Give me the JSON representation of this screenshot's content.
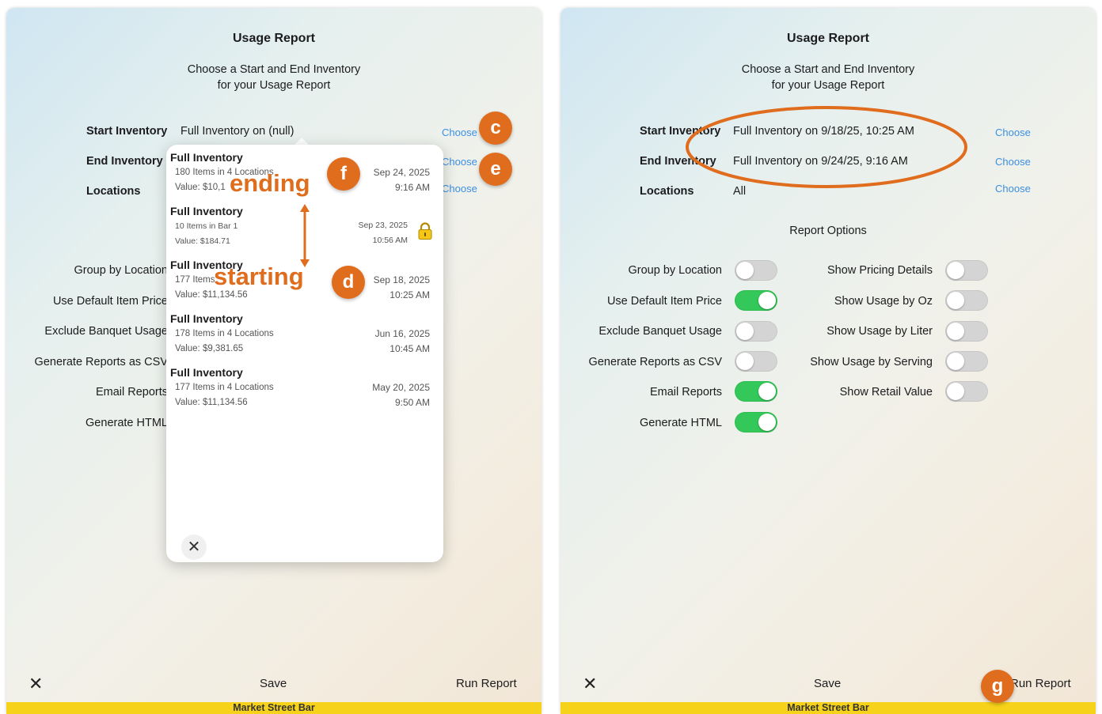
{
  "left": {
    "title": "Usage Report",
    "subtitle_line1": "Choose a Start and End Inventory",
    "subtitle_line2": "for your Usage Report",
    "start_label": "Start Inventory",
    "start_value": "Full Inventory on (null)",
    "end_label": "End Inventory",
    "locations_label": "Locations",
    "choose": "Choose",
    "options": [
      "Group by Location",
      "Use Default Item Price",
      "Exclude Banquet Usage",
      "Generate Reports as CSV",
      "Email Reports",
      "Generate HTML"
    ],
    "close_glyph": "✕",
    "save": "Save",
    "run": "Run Report",
    "footer": "Market Street Bar"
  },
  "popover": {
    "items": [
      {
        "name": "Full Inventory",
        "count": "180 Items in 4 Locations",
        "value": "Value: $10,1",
        "date": "Sep 24, 2025",
        "time": "9:16 AM"
      },
      {
        "name": "Full Inventory",
        "count": "10 Items in Bar 1",
        "value": "Value: $184.71",
        "date": "Sep 23, 2025",
        "time": "10:56 AM",
        "locked": true
      },
      {
        "name": "Full Inventory",
        "count": "177 Items",
        "value": "Value: $11,134.56",
        "date": "Sep 18, 2025",
        "time": "10:25 AM"
      },
      {
        "name": "Full Inventory",
        "count": "178 Items in 4 Locations",
        "value": "Value: $9,381.65",
        "date": "Jun 16, 2025",
        "time": "10:45 AM"
      },
      {
        "name": "Full Inventory",
        "count": "177 Items in 4 Locations",
        "value": "Value: $11,134.56",
        "date": "May 20, 2025",
        "time": "9:50 AM"
      }
    ],
    "close_glyph": "✕"
  },
  "annotations": {
    "c": "c",
    "e": "e",
    "f": "f",
    "d": "d",
    "g": "g",
    "ending": "ending",
    "starting": "starting",
    "color": "#e06c1d"
  },
  "right": {
    "title": "Usage Report",
    "subtitle_line1": "Choose a Start and End Inventory",
    "subtitle_line2": "for your Usage Report",
    "start_label": "Start Inventory",
    "start_value": "Full Inventory on 9/18/25, 10:25 AM",
    "end_label": "End Inventory",
    "end_value": "Full Inventory on 9/24/25, 9:16 AM",
    "locations_label": "Locations",
    "locations_value": "All",
    "choose": "Choose",
    "report_options": "Report Options",
    "left_options": [
      {
        "label": "Group by Location",
        "on": false
      },
      {
        "label": "Use Default Item Price",
        "on": true
      },
      {
        "label": "Exclude Banquet Usage",
        "on": false
      },
      {
        "label": "Generate Reports as CSV",
        "on": false
      },
      {
        "label": "Email Reports",
        "on": true
      },
      {
        "label": "Generate HTML",
        "on": true
      }
    ],
    "right_options": [
      {
        "label": "Show Pricing Details",
        "on": false
      },
      {
        "label": "Show Usage by Oz",
        "on": false
      },
      {
        "label": "Show Usage by Liter",
        "on": false
      },
      {
        "label": "Show Usage by Serving",
        "on": false
      },
      {
        "label": "Show Retail Value",
        "on": false
      }
    ],
    "close_glyph": "✕",
    "save": "Save",
    "run": "Run Report",
    "footer": "Market Street Bar"
  }
}
